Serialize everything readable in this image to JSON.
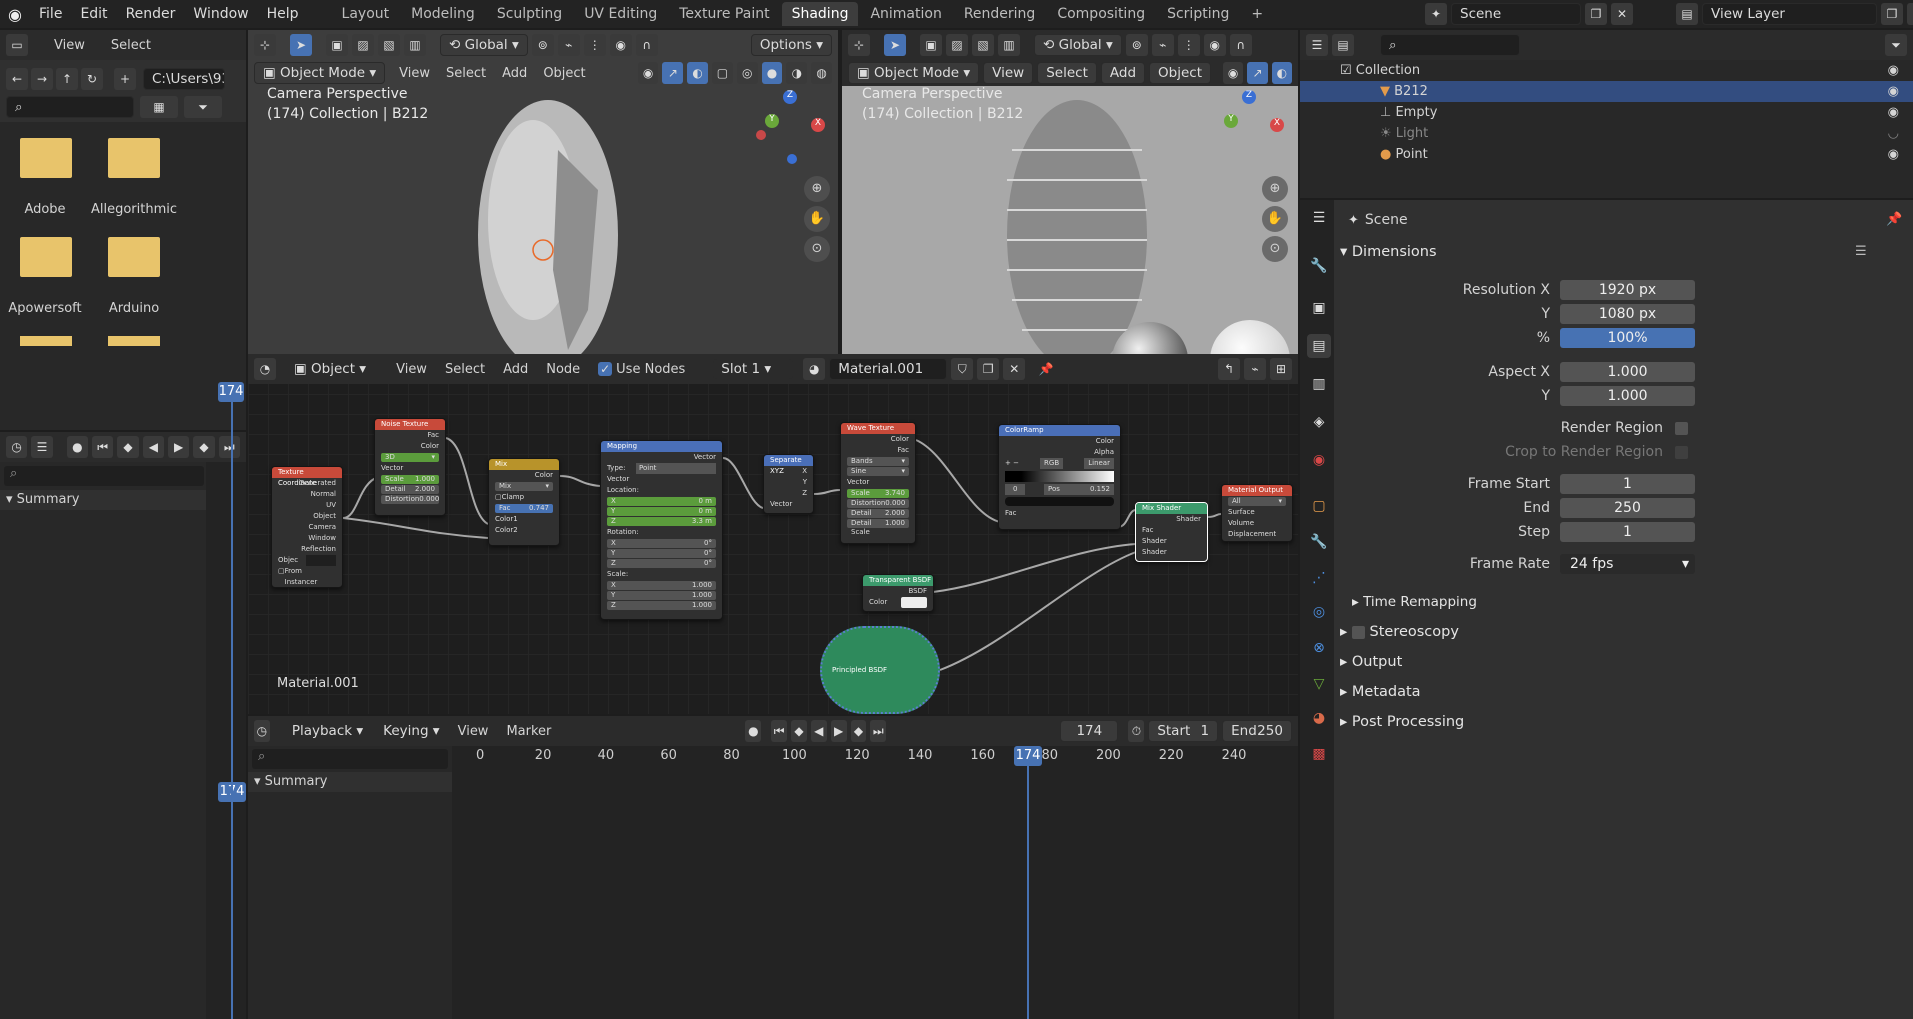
{
  "topbar": {
    "menus": [
      "File",
      "Edit",
      "Render",
      "Window",
      "Help"
    ],
    "workspaces": [
      "Layout",
      "Modeling",
      "Sculpting",
      "UV Editing",
      "Texture Paint",
      "Shading",
      "Animation",
      "Rendering",
      "Compositing",
      "Scripting"
    ],
    "active_workspace": "Shading",
    "add_tab": "+",
    "scene": "Scene",
    "view_layer": "View Layer"
  },
  "filebrowser": {
    "menus": [
      "View",
      "Select"
    ],
    "path": "C:\\Users\\93..",
    "folders": [
      "Adobe",
      "Allegorithmic",
      "Apowersoft",
      "Arduino"
    ]
  },
  "viewport_left": {
    "mode": "Object Mode",
    "menus": [
      "View",
      "Select",
      "Add",
      "Object"
    ],
    "transform": "Global",
    "options": "Options",
    "title": "Camera Perspective",
    "subtitle": "(174) Collection | B212"
  },
  "viewport_right": {
    "mode": "Object Mode",
    "menus": [
      "View",
      "Select",
      "Add",
      "Object"
    ],
    "transform": "Global",
    "title": "Camera Perspective",
    "subtitle": "(174) Collection | B212"
  },
  "gizmo": {
    "z": "Z",
    "y": "Y",
    "x": "X"
  },
  "outliner": {
    "items": [
      {
        "name": "Collection",
        "indent": 0
      },
      {
        "name": "B212",
        "indent": 1
      },
      {
        "name": "Empty",
        "indent": 1
      },
      {
        "name": "Light",
        "indent": 1
      },
      {
        "name": "Point",
        "indent": 1
      }
    ]
  },
  "properties": {
    "context": "Scene",
    "section": "Dimensions",
    "resolution_x_label": "Resolution X",
    "resolution_x": "1920 px",
    "y_label": "Y",
    "resolution_y": "1080 px",
    "percent_label": "%",
    "percent": "100%",
    "aspect_x_label": "Aspect X",
    "aspect_x": "1.000",
    "aspect_y": "1.000",
    "render_region": "Render Region",
    "crop": "Crop to Render Region",
    "frame_start_label": "Frame Start",
    "frame_start": "1",
    "end_label": "End",
    "end": "250",
    "step_label": "Step",
    "step": "1",
    "frame_rate_label": "Frame Rate",
    "frame_rate": "24 fps",
    "subsections": [
      "Time Remapping",
      "Stereoscopy",
      "Output",
      "Metadata",
      "Post Processing"
    ]
  },
  "dopesheet": {
    "frame": "174",
    "summary": "Summary"
  },
  "node_editor": {
    "type": "Object",
    "menus": [
      "View",
      "Select",
      "Add",
      "Node"
    ],
    "use_nodes": "Use Nodes",
    "slot": "Slot 1",
    "material": "Material.001",
    "material_label": "Material.001",
    "nodes": {
      "texcoord": {
        "title": "Texture Coordinate",
        "outs": [
          "Generated",
          "Normal",
          "UV",
          "Object",
          "Camera",
          "Window",
          "Reflection"
        ],
        "obj": "Objec",
        "inst": "From Instancer"
      },
      "noise": {
        "title": "Noise Texture",
        "outs": [
          "Fac",
          "Color"
        ],
        "dim": "3D",
        "vec": "Vector",
        "scale": "Scale",
        "scale_v": "1.000",
        "detail": "Detail",
        "detail_v": "2.000",
        "dist": "Distortion",
        "dist_v": "0.000"
      },
      "mix": {
        "title": "Mix",
        "out": "Color",
        "mode": "Mix",
        "clamp": "Clamp",
        "fac": "Fac",
        "fac_v": "0.747",
        "c1": "Color1",
        "c2": "Color2"
      },
      "mapping": {
        "title": "Mapping",
        "out": "Vector",
        "type": "Type:",
        "type_v": "Point",
        "vec": "Vector",
        "loc": "Location:",
        "x": "X",
        "y": "Y",
        "z": "Z",
        "lx": "0 m",
        "ly": "0 m",
        "lz": "3.3 m",
        "rot": "Rotation:",
        "r": "0°",
        "scale": "Scale:",
        "s": "1.000"
      },
      "sepxyz": {
        "title": "Separate XYZ",
        "outs": [
          "X",
          "Y",
          "Z"
        ],
        "in": "Vector"
      },
      "wave": {
        "title": "Wave Texture",
        "outs": [
          "Color",
          "Fac"
        ],
        "type": "Bands",
        "profile": "Sine",
        "vec": "Vector",
        "scale": "Scale",
        "scale_v": "3.740",
        "dist": "Distortion",
        "dist_v": "0.000",
        "detail": "Detail",
        "detail_v": "2.000",
        "ds": "Detail Scale",
        "ds_v": "1.000"
      },
      "ramp": {
        "title": "ColorRamp",
        "outs": [
          "Color",
          "Alpha"
        ],
        "mode": "RGB",
        "interp": "Linear",
        "idx": "0",
        "pos": "Pos",
        "pos_v": "0.152",
        "fac": "Fac"
      },
      "mixshader": {
        "title": "Mix Shader",
        "out": "Shader",
        "ins": [
          "Fac",
          "Shader",
          "Shader"
        ]
      },
      "output": {
        "title": "Material Output",
        "target": "All",
        "ins": [
          "Surface",
          "Volume",
          "Displacement"
        ]
      },
      "transparent": {
        "title": "Transparent BSDF",
        "out": "BSDF",
        "color": "Color"
      },
      "principled": {
        "title": "Principled BSDF"
      }
    }
  },
  "timeline": {
    "menus": [
      "Playback",
      "Keying",
      "View",
      "Marker"
    ],
    "frame": "174",
    "start_label": "Start",
    "start": "1",
    "end_label": "End",
    "end": "250",
    "summary": "Summary",
    "ticks": [
      "0",
      "20",
      "40",
      "60",
      "80",
      "100",
      "120",
      "140",
      "160",
      "180",
      "200",
      "220",
      "240"
    ],
    "current": "174"
  }
}
